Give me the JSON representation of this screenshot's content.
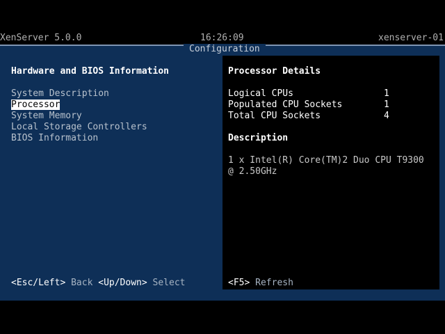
{
  "topbar": {
    "product": "XenServer 5.0.0",
    "clock": "16:26:09",
    "hostname": "xenserver-01"
  },
  "dialog": {
    "title": "Configuration"
  },
  "left": {
    "heading": "Hardware and BIOS Information",
    "menu": [
      "System Description",
      "Processor",
      "System Memory",
      "Local Storage Controllers",
      "BIOS Information"
    ],
    "selected_index": 1
  },
  "right": {
    "heading": "Processor Details",
    "rows": [
      {
        "label": "Logical CPUs",
        "value": "1"
      },
      {
        "label": "Populated CPU Sockets",
        "value": "1"
      },
      {
        "label": "Total CPU Sockets",
        "value": "4"
      }
    ],
    "description_heading": "Description",
    "description_lines": [
      "1 x Intel(R) Core(TM)2 Duo CPU T9300",
      "@ 2.50GHz"
    ]
  },
  "footer": {
    "left_hints": [
      {
        "key": "<Esc/Left>",
        "action": "Back"
      },
      {
        "key": "<Up/Down>",
        "action": "Select"
      }
    ],
    "right_hints": [
      {
        "key": "<F5>",
        "action": "Refresh"
      }
    ]
  },
  "colors": {
    "dialog_background": "#0e2f57",
    "pane_background": "#000000",
    "selection_background": "#ffffff",
    "selection_text": "#000000",
    "border": "#7f96b3"
  }
}
